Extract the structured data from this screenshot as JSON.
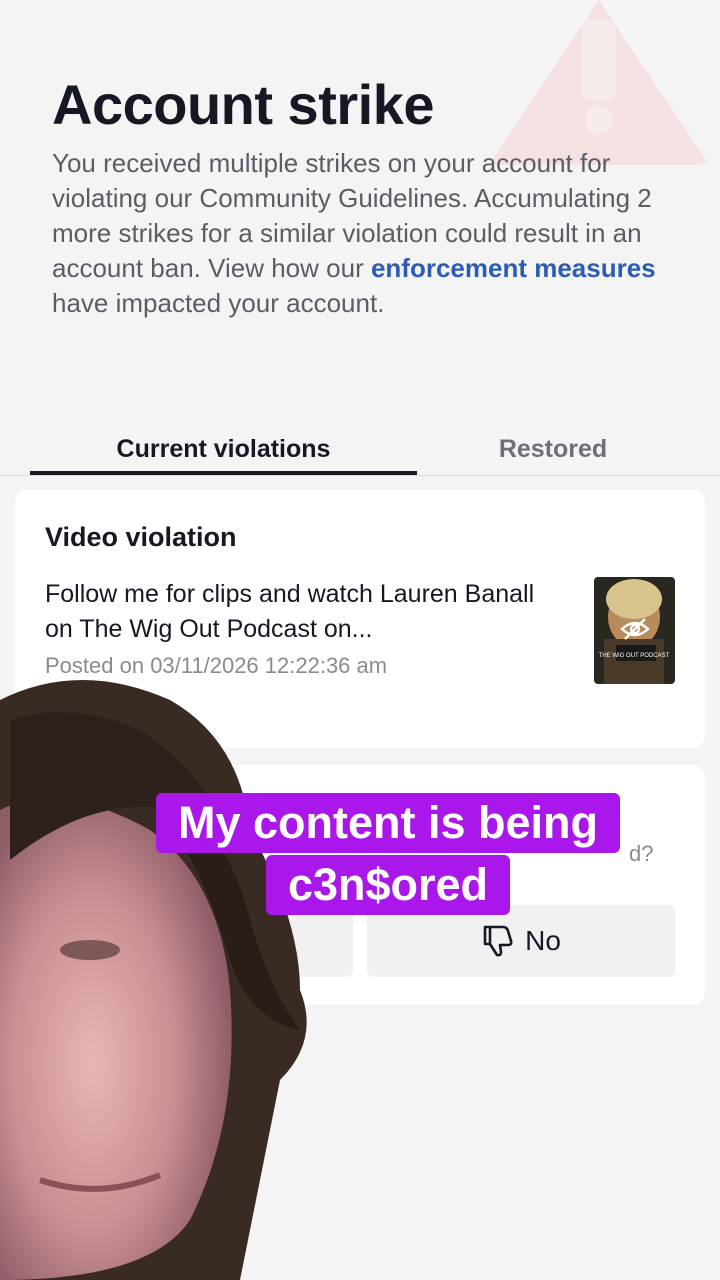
{
  "header": {
    "title": "Account strike",
    "description_before_link": "You received multiple strikes on your account for violating our Community Guidelines. Accumulating 2 more strikes for a similar violation could result in an account ban. View how our ",
    "description_link": "enforcement measures",
    "description_after_link": " have impacted your account."
  },
  "tabs": [
    {
      "label": "Current violations",
      "active": true
    },
    {
      "label": "Restored",
      "active": false
    }
  ],
  "violation_card": {
    "title": "Video violation",
    "video_text": "Follow me for clips and watch Lauren Banall on The Wig Out Podcast on...",
    "posted": "Posted on 03/11/2026 12:22:36 am",
    "thumbnail_text": "THE WIG OUT PODCAST"
  },
  "feedback_card": {
    "question_fragment": "d?",
    "no_label": "No"
  },
  "caption": {
    "line1": "My content is being",
    "line2": "c3n$ored",
    "color": "#a917ea"
  },
  "colors": {
    "link": "#2b5db6",
    "warning_bg": "#f6c9c9",
    "background": "#f4f4f5"
  }
}
